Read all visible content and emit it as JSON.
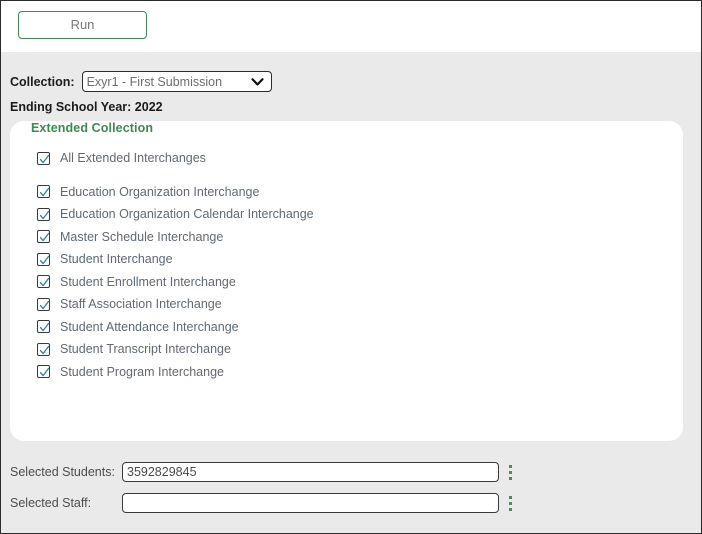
{
  "toolbar": {
    "run_label": "Run"
  },
  "filters": {
    "collection_label": "Collection:",
    "collection_value": "Exyr1 - First Submission",
    "collection_options": [
      "Exyr1 - First Submission"
    ],
    "caret_icon": "chevron-down-icon",
    "school_year_text": "Ending School Year: 2022"
  },
  "card": {
    "title": "Extended Collection",
    "items": [
      {
        "label": "All Extended Interchanges",
        "checked": true
      },
      {
        "label": "Education Organization Interchange",
        "checked": true
      },
      {
        "label": "Education Organization Calendar Interchange",
        "checked": true
      },
      {
        "label": "Master Schedule Interchange",
        "checked": true
      },
      {
        "label": "Student Interchange",
        "checked": true
      },
      {
        "label": "Student Enrollment Interchange",
        "checked": true
      },
      {
        "label": "Staff Association Interchange",
        "checked": true
      },
      {
        "label": "Student Attendance Interchange",
        "checked": true
      },
      {
        "label": "Student Transcript Interchange",
        "checked": true
      },
      {
        "label": "Student Program Interchange",
        "checked": true
      }
    ]
  },
  "selection": {
    "students_label": "Selected Students:",
    "students_value": "3592829845",
    "students_placeholder": "",
    "staff_label": "Selected Staff:",
    "staff_value": "",
    "staff_placeholder": "",
    "menu_icon": "kebab-menu-icon"
  },
  "colors": {
    "accent_green": "#3f8a52",
    "kebab_green": "#4d8a5c",
    "check_blue": "#2f7fa8",
    "page_background": "#eaeaea",
    "card_background": "#ffffff",
    "label_text": "#5e6a78"
  }
}
